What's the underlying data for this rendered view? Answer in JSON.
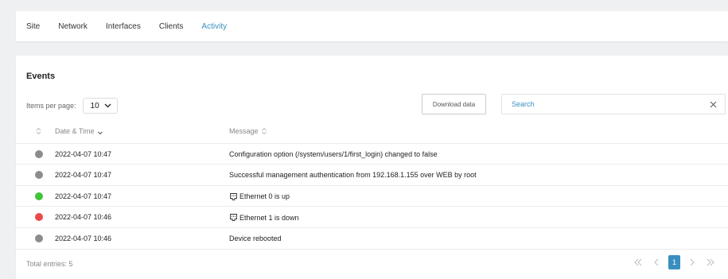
{
  "nav": {
    "tabs": [
      "Site",
      "Network",
      "Interfaces",
      "Clients",
      "Activity"
    ],
    "active_tab": "Activity"
  },
  "events": {
    "title": "Events",
    "items_per_page_label": "Items per page:",
    "items_per_page_value": "10",
    "download_label": "Download data",
    "search_placeholder": "Search",
    "columns": {
      "datetime": "Date & Time",
      "message": "Message"
    },
    "rows": [
      {
        "status": "info",
        "color": "#8c8c8c",
        "time": "2022-04-07 10:47",
        "message": "Configuration option (/system/users/1/first_login) changed to false",
        "icon": ""
      },
      {
        "status": "info",
        "color": "#8c8c8c",
        "time": "2022-04-07 10:47",
        "message": "Successful management authentication from 192.168.1.155 over WEB by root",
        "icon": ""
      },
      {
        "status": "up",
        "color": "#3fc43a",
        "time": "2022-04-07 10:47",
        "message": "Ethernet 0 is up",
        "icon": "ethernet-port-icon"
      },
      {
        "status": "down",
        "color": "#e84a4a",
        "time": "2022-04-07 10:46",
        "message": "Ethernet 1 is down",
        "icon": "ethernet-port-icon"
      },
      {
        "status": "info",
        "color": "#8c8c8c",
        "time": "2022-04-07 10:46",
        "message": "Device rebooted",
        "icon": ""
      }
    ],
    "total_label": "Total entries: 5",
    "pagination": {
      "current_page": "1"
    }
  },
  "colors": {
    "accent": "#3a8fc1",
    "background": "#eef0f2"
  }
}
